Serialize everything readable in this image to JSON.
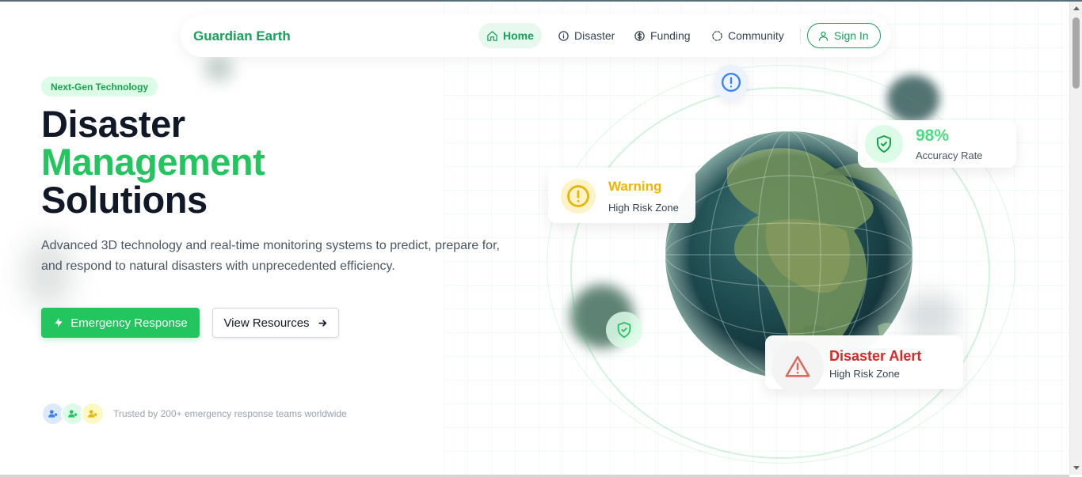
{
  "nav": {
    "brand": "Guardian Earth",
    "items": [
      {
        "label": "Home",
        "icon": "home-icon",
        "active": true
      },
      {
        "label": "Disaster",
        "icon": "info-circle-icon"
      },
      {
        "label": "Funding",
        "icon": "dollar-circle-icon"
      },
      {
        "label": "Community",
        "icon": "dashed-circle-icon"
      }
    ],
    "sign_in": "Sign In"
  },
  "hero": {
    "badge": "Next-Gen Technology",
    "title_line1": "Disaster",
    "title_line2": "Management",
    "title_line3": "Solutions",
    "description": "Advanced 3D technology and real-time monitoring systems to predict, prepare for, and respond to natural disasters with unprecedented efficiency.",
    "primary_button": "Emergency Response",
    "secondary_button": "View Resources",
    "trusted_text": "Trusted by 200+ emergency response teams worldwide"
  },
  "cards": {
    "warning": {
      "title": "Warning",
      "subtitle": "High Risk Zone"
    },
    "accuracy": {
      "value": "98%",
      "label": "Accuracy Rate"
    },
    "alert": {
      "title": "Disaster Alert",
      "subtitle": "High Risk Zone"
    }
  },
  "colors": {
    "brand_green": "#16a05a",
    "accent_green": "#22c55e",
    "warning_yellow": "#f5b301",
    "alert_red": "#dc2626"
  }
}
